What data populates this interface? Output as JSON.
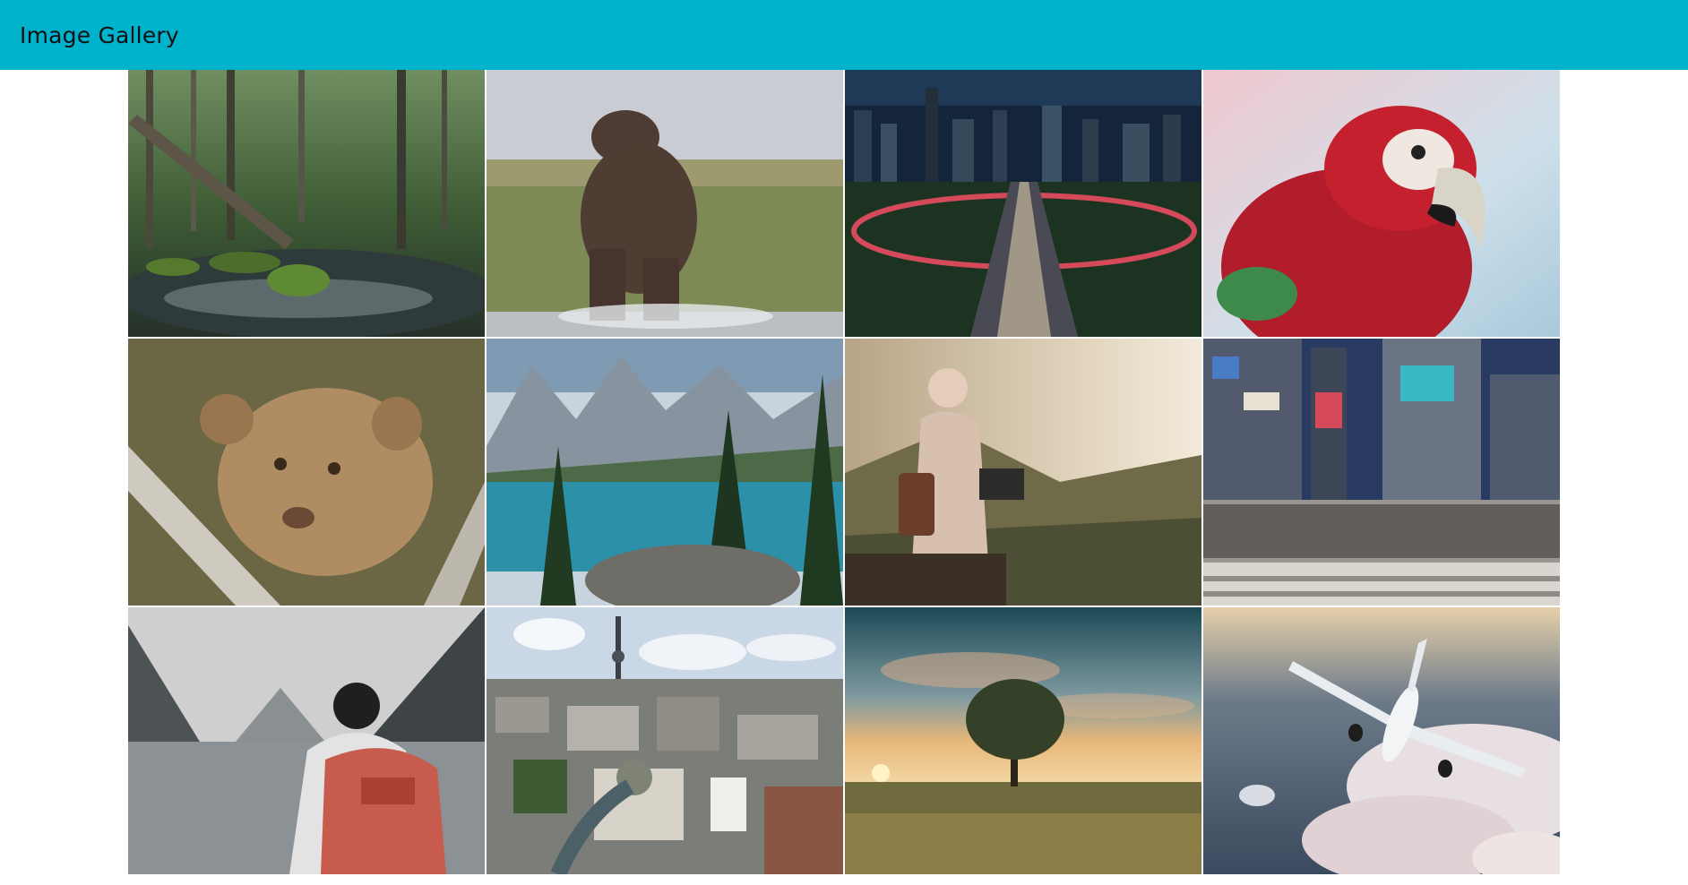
{
  "header": {
    "title": "Image Gallery"
  },
  "colors": {
    "header_background": "#00b3cc",
    "page_background": "#ffffff"
  },
  "gallery": {
    "images": [
      {
        "subject": "forest-stream"
      },
      {
        "subject": "hippopotamus"
      },
      {
        "subject": "city-at-night"
      },
      {
        "subject": "red-macaw"
      },
      {
        "subject": "lion-cub"
      },
      {
        "subject": "mountain-lake"
      },
      {
        "subject": "woman-with-laptop"
      },
      {
        "subject": "city-crossing"
      },
      {
        "subject": "hiker-by-lake"
      },
      {
        "subject": "city-with-tv-tower"
      },
      {
        "subject": "tree-at-sunset"
      },
      {
        "subject": "airplane-above-clouds"
      }
    ]
  }
}
